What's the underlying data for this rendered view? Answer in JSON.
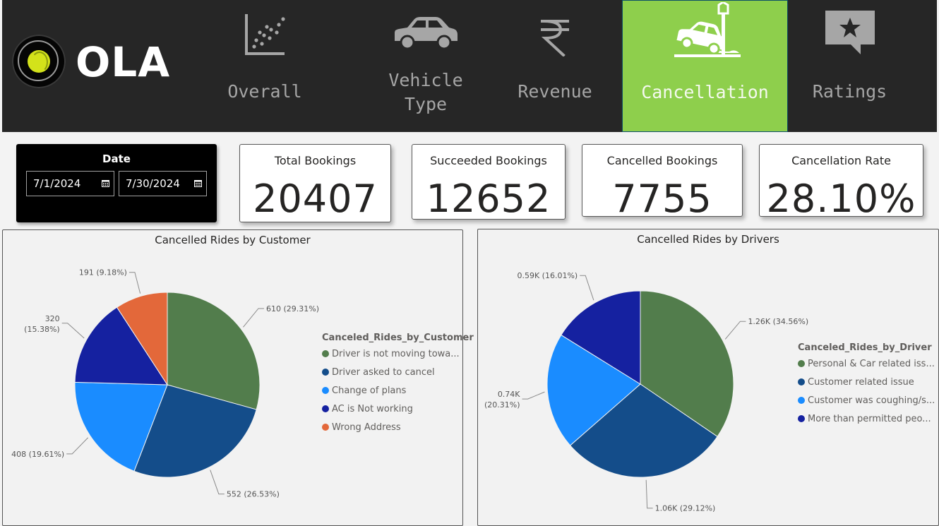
{
  "brand": {
    "logo_text": "OLA"
  },
  "nav": {
    "items": [
      {
        "label": "Overall",
        "icon": "scatter-chart-icon"
      },
      {
        "label": "Vehicle Type",
        "icon": "car-icon"
      },
      {
        "label": "Revenue",
        "icon": "rupee-icon"
      },
      {
        "label": "Cancellation",
        "icon": "car-crash-icon",
        "active": true
      },
      {
        "label": "Ratings",
        "icon": "star-comment-icon"
      }
    ]
  },
  "date_filter": {
    "title": "Date",
    "start": "7/1/2024",
    "end": "7/30/2024"
  },
  "kpis": [
    {
      "label": "Total Bookings",
      "value": "20407"
    },
    {
      "label": "Succeeded Bookings",
      "value": "12652"
    },
    {
      "label": "Cancelled Bookings",
      "value": "7755"
    },
    {
      "label": "Cancellation Rate",
      "value": "28.10%"
    }
  ],
  "colors": {
    "green": "#527d4c",
    "navy": "#144d8a",
    "sky": "#1a8cff",
    "indigo": "#1521a0",
    "orange": "#e3683a",
    "active_tab": "#8ecf4c"
  },
  "chart_data": [
    {
      "type": "pie",
      "title": "Cancelled Rides by Customer",
      "legend_title": "Canceled_Rides_by_Customer",
      "categories": [
        "Driver is not moving towa...",
        "Driver asked to cancel",
        "Change of plans",
        "AC is Not working",
        "Wrong Address"
      ],
      "values": [
        610,
        552,
        408,
        320,
        191
      ],
      "labels": [
        "610 (29.31%)",
        "552 (26.53%)",
        "408 (19.61%)",
        "320\n(15.38%)",
        "191 (9.18%)"
      ],
      "colors": [
        "#527d4c",
        "#144d8a",
        "#1a8cff",
        "#1521a0",
        "#e3683a"
      ],
      "legend_position": "right"
    },
    {
      "type": "pie",
      "title": "Cancelled Rides by Drivers",
      "legend_title": "Canceled_Rides_by_Driver",
      "categories": [
        "Personal & Car related iss...",
        "Customer related issue",
        "Customer was coughing/s...",
        "More than permitted peo..."
      ],
      "values": [
        1260,
        1060,
        740,
        590
      ],
      "labels": [
        "1.26K (34.56%)",
        "1.06K (29.12%)",
        "0.74K\n(20.31%)",
        "0.59K (16.01%)"
      ],
      "colors": [
        "#527d4c",
        "#144d8a",
        "#1a8cff",
        "#1521a0"
      ],
      "legend_position": "right"
    }
  ]
}
